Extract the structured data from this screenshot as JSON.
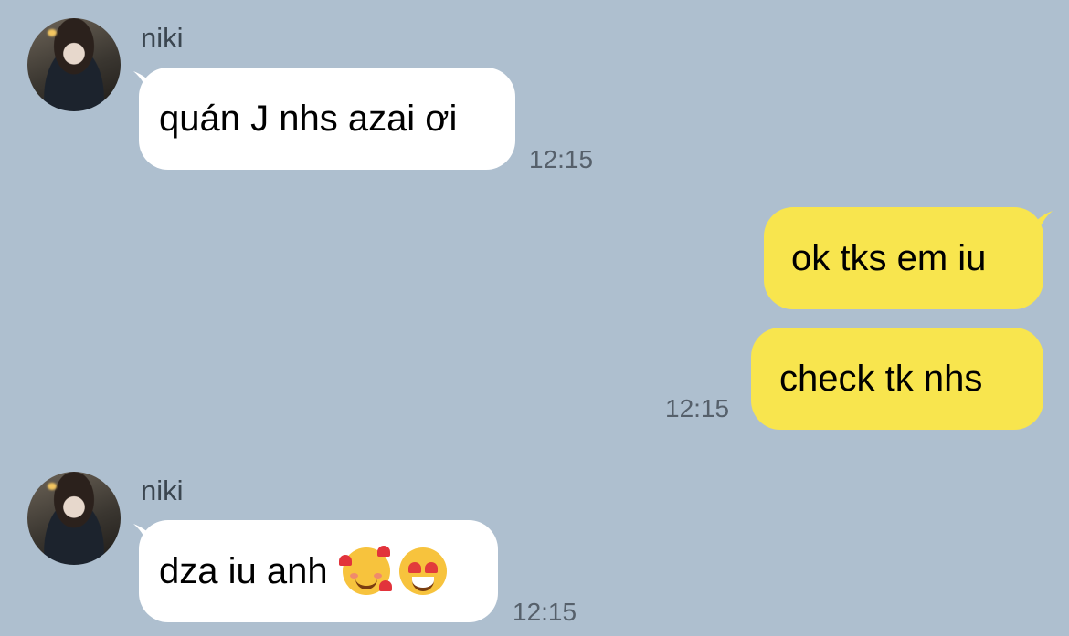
{
  "messages": [
    {
      "sender": "niki",
      "text": "quán J nhs azai ơi",
      "time": "12:15"
    },
    {
      "text": "ok tks em iu"
    },
    {
      "text": "check tk nhs",
      "time": "12:15"
    },
    {
      "sender": "niki",
      "text": "dza iu anh",
      "time": "12:15",
      "emojis": [
        "smiling-face-with-hearts",
        "heart-eyes"
      ]
    }
  ],
  "colors": {
    "background": "#aebfcf",
    "incoming": "#ffffff",
    "outgoing": "#f8e54e"
  }
}
